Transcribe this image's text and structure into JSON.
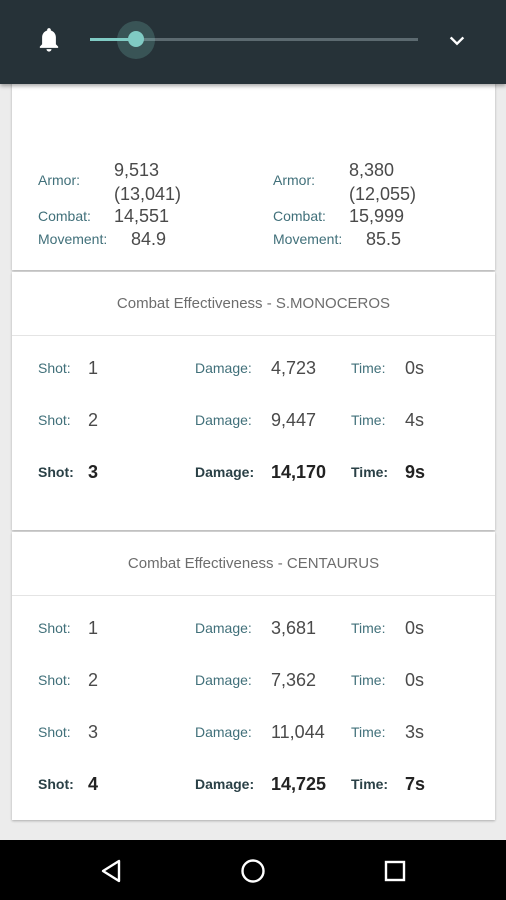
{
  "notification_shade": {
    "brightness_level": 0.14
  },
  "stats": {
    "left": {
      "armor_label": "Armor:",
      "armor_value": "9,513",
      "armor_max": "(13,041)",
      "movement_label": "Movement:",
      "movement_value": "84.9",
      "combat_label": "Combat:",
      "combat_value": "14,551"
    },
    "right": {
      "armor_label": "Armor:",
      "armor_value": "8,380",
      "armor_max": "(12,055)",
      "movement_label": "Movement:",
      "movement_value": "85.5",
      "combat_label": "Combat:",
      "combat_value": "15,999"
    }
  },
  "effectiveness": [
    {
      "title": "Combat Effectiveness - S.MONOCEROS",
      "rows": [
        {
          "shot_label": "Shot:",
          "shot": "1",
          "damage_label": "Damage:",
          "damage": "4,723",
          "time_label": "Time:",
          "time": "0s"
        },
        {
          "shot_label": "Shot:",
          "shot": "2",
          "damage_label": "Damage:",
          "damage": "9,447",
          "time_label": "Time:",
          "time": "4s"
        },
        {
          "shot_label": "Shot:",
          "shot": "3",
          "damage_label": "Damage:",
          "damage": "14,170",
          "time_label": "Time:",
          "time": "9s",
          "final": true
        }
      ]
    },
    {
      "title": "Combat Effectiveness - CENTAURUS",
      "rows": [
        {
          "shot_label": "Shot:",
          "shot": "1",
          "damage_label": "Damage:",
          "damage": "3,681",
          "time_label": "Time:",
          "time": "0s"
        },
        {
          "shot_label": "Shot:",
          "shot": "2",
          "damage_label": "Damage:",
          "damage": "7,362",
          "time_label": "Time:",
          "time": "0s"
        },
        {
          "shot_label": "Shot:",
          "shot": "3",
          "damage_label": "Damage:",
          "damage": "11,044",
          "time_label": "Time:",
          "time": "3s"
        },
        {
          "shot_label": "Shot:",
          "shot": "4",
          "damage_label": "Damage:",
          "damage": "14,725",
          "time_label": "Time:",
          "time": "7s",
          "final": true
        }
      ]
    }
  ],
  "icons": {
    "bell": "bell-icon",
    "expand": "chevron-down-icon",
    "back": "back-triangle-icon",
    "home": "home-circle-icon",
    "recents": "recents-square-icon"
  },
  "colors": {
    "shade": "#263238",
    "accent": "#80cbc4",
    "label": "#41707a",
    "app_bar": "#2f6f72"
  }
}
